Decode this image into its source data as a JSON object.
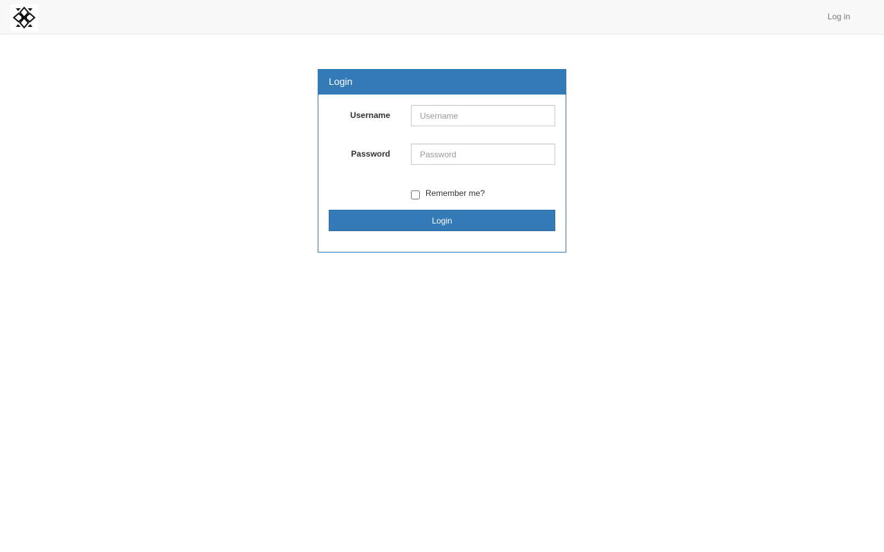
{
  "navbar": {
    "logo_icon": "iatse-logo-icon",
    "login_link": "Log in"
  },
  "panel": {
    "title": "Login",
    "accent_color": "#337ab7",
    "username": {
      "label": "Username",
      "placeholder": "Username",
      "value": ""
    },
    "password": {
      "label": "Password",
      "placeholder": "Password",
      "value": ""
    },
    "remember": {
      "label": "Remember me?",
      "checked": false
    },
    "submit_label": "Login"
  }
}
